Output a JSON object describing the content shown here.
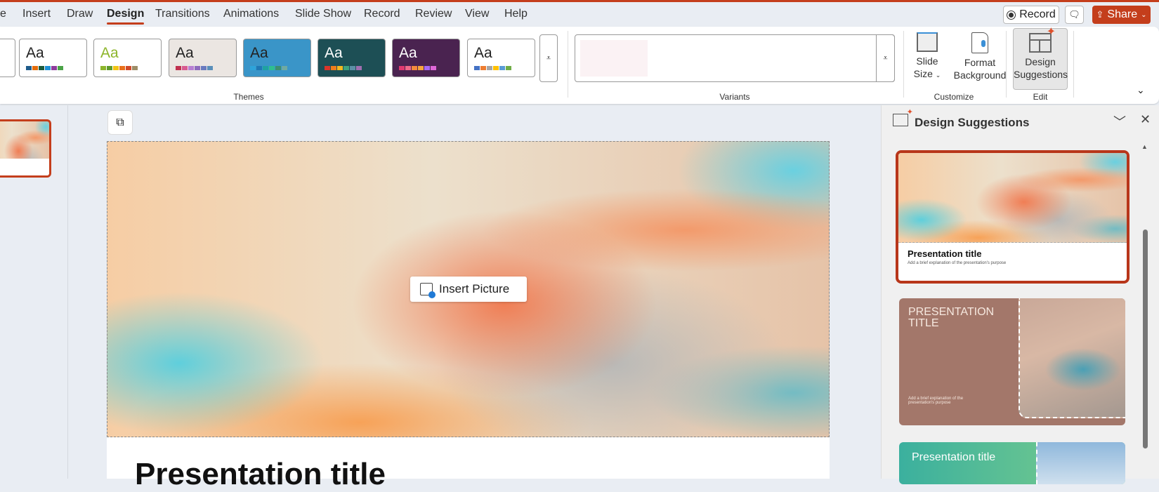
{
  "tabs": [
    "e",
    "Insert",
    "Draw",
    "Design",
    "Transitions",
    "Animations",
    "Slide Show",
    "Record",
    "Review",
    "View",
    "Help"
  ],
  "active_tab": "Design",
  "header_buttons": {
    "record": "Record",
    "share": "Share"
  },
  "ribbon": {
    "themes": [
      {
        "text": "Aa",
        "bg": "#ffffff",
        "fg": "#222",
        "colors": [
          "#1f5c8b",
          "#e46c0a",
          "#1d5a3a",
          "#1e90d6",
          "#8e3b9c",
          "#4aa347"
        ]
      },
      {
        "text": "Aa",
        "bg": "#ffffff",
        "fg": "#8db52b",
        "colors": [
          "#8db52b",
          "#5e9a2b",
          "#f2c314",
          "#e9711c",
          "#d14a2a",
          "#9c8d67"
        ]
      },
      {
        "text": "Aa",
        "bg": "#ebe6e2",
        "fg": "#222",
        "colors": [
          "#c0304f",
          "#d85a90",
          "#b87fd3",
          "#8e6bbd",
          "#6a7bbf",
          "#5a8fba"
        ]
      },
      {
        "text": "Aa",
        "bg": "#3a95c8",
        "fg": "#222",
        "colors": [
          "#2ea3d9",
          "#1f77b4",
          "#1fa2a2",
          "#2ebf8f",
          "#3d8f6f",
          "#6fa9a2"
        ]
      },
      {
        "text": "Aa",
        "bg": "#1d4f55",
        "fg": "#ffffff",
        "colors": [
          "#d9352a",
          "#f07d1a",
          "#f5b820",
          "#3fa27e",
          "#5c8fa6",
          "#a06fb0"
        ]
      },
      {
        "text": "Aa",
        "bg": "#4a2350",
        "fg": "#ffffff",
        "colors": [
          "#e0396f",
          "#f06a8a",
          "#f58b3d",
          "#f6a63e",
          "#a86bf5",
          "#e067d8"
        ]
      },
      {
        "text": "Aa",
        "bg": "#ffffff",
        "fg": "#222",
        "colors": [
          "#4472c4",
          "#ed7d31",
          "#a5a5a5",
          "#ffc000",
          "#5b9bd5",
          "#70ad47"
        ]
      }
    ],
    "groups": {
      "themes": "Themes",
      "variants": "Variants",
      "customize": "Customize",
      "edit": "Edit"
    },
    "slide_size": [
      "Slide",
      "Size"
    ],
    "format_background": [
      "Format",
      "Background"
    ],
    "design_suggestions": [
      "Design",
      "Suggestions"
    ]
  },
  "slide": {
    "insert_picture": "Insert Picture",
    "title": "Presentation title"
  },
  "pane": {
    "title": "Design Suggestions",
    "cards": [
      {
        "title": "Presentation title",
        "subtitle": "Add a brief explanation of the presentation's purpose"
      },
      {
        "title": "PRESENTATION TITLE",
        "subtitle": "Add a brief explanation of the presentation's purpose"
      },
      {
        "title": "Presentation title"
      }
    ]
  },
  "accent": "#c43e1c"
}
